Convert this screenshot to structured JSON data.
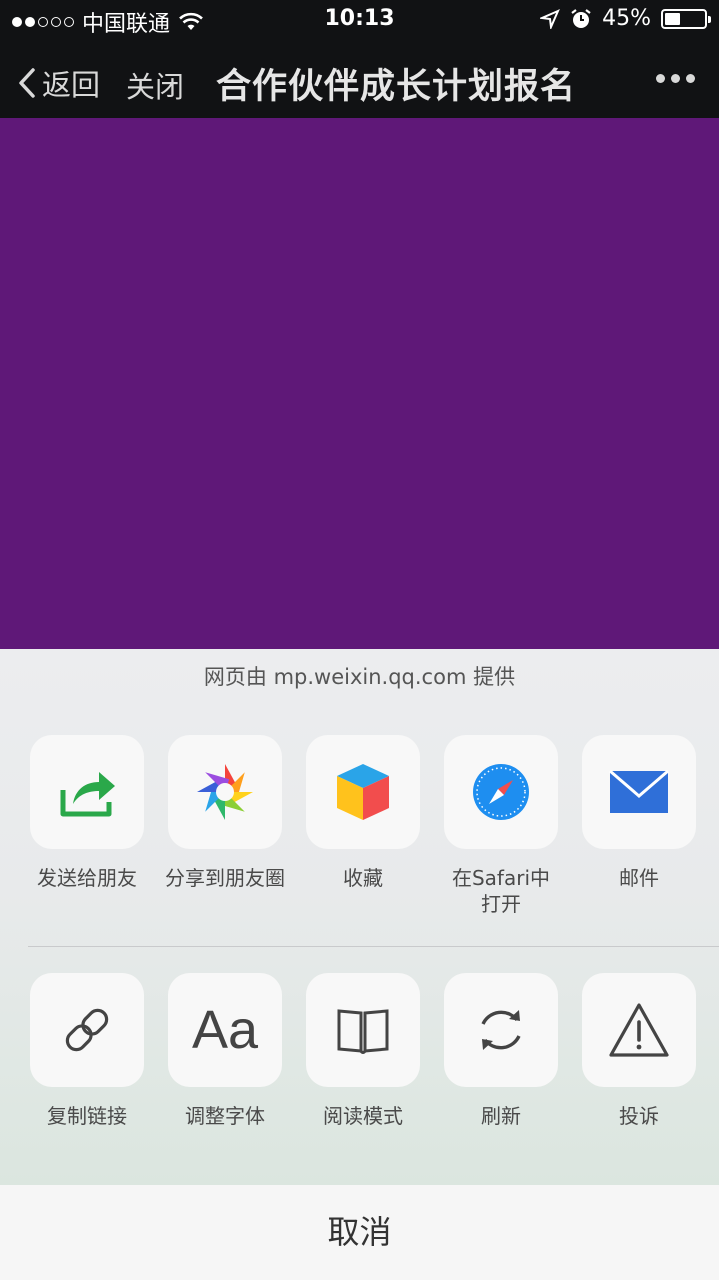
{
  "status": {
    "carrier": "中国联通",
    "time": "10:13",
    "battery": "45%",
    "battery_level": 0.45
  },
  "nav": {
    "back_label": "返回",
    "close_label": "关闭",
    "title": "合作伙伴成长计划报名"
  },
  "sheet": {
    "provider_text": "网页由 mp.weixin.qq.com 提供",
    "row1": [
      {
        "label": "发送给朋友",
        "icon": "send-to-friend-icon"
      },
      {
        "label": "分享到朋友圈",
        "icon": "moments-icon"
      },
      {
        "label": "收藏",
        "icon": "favorite-cube-icon"
      },
      {
        "label": "在Safari中打开",
        "icon": "safari-compass-icon"
      },
      {
        "label": "邮件",
        "icon": "mail-icon"
      }
    ],
    "row2": [
      {
        "label": "复制链接",
        "icon": "link-icon"
      },
      {
        "label": "调整字体",
        "icon": "font-size-icon",
        "glyph": "Aa"
      },
      {
        "label": "阅读模式",
        "icon": "book-icon"
      },
      {
        "label": "刷新",
        "icon": "refresh-icon"
      },
      {
        "label": "投诉",
        "icon": "warning-icon"
      }
    ],
    "cancel_label": "取消"
  },
  "colors": {
    "page_bg": "#5f1878",
    "bar_bg": "#111214",
    "share_green": "#2aa84a",
    "mail_blue": "#2f6fd8"
  }
}
